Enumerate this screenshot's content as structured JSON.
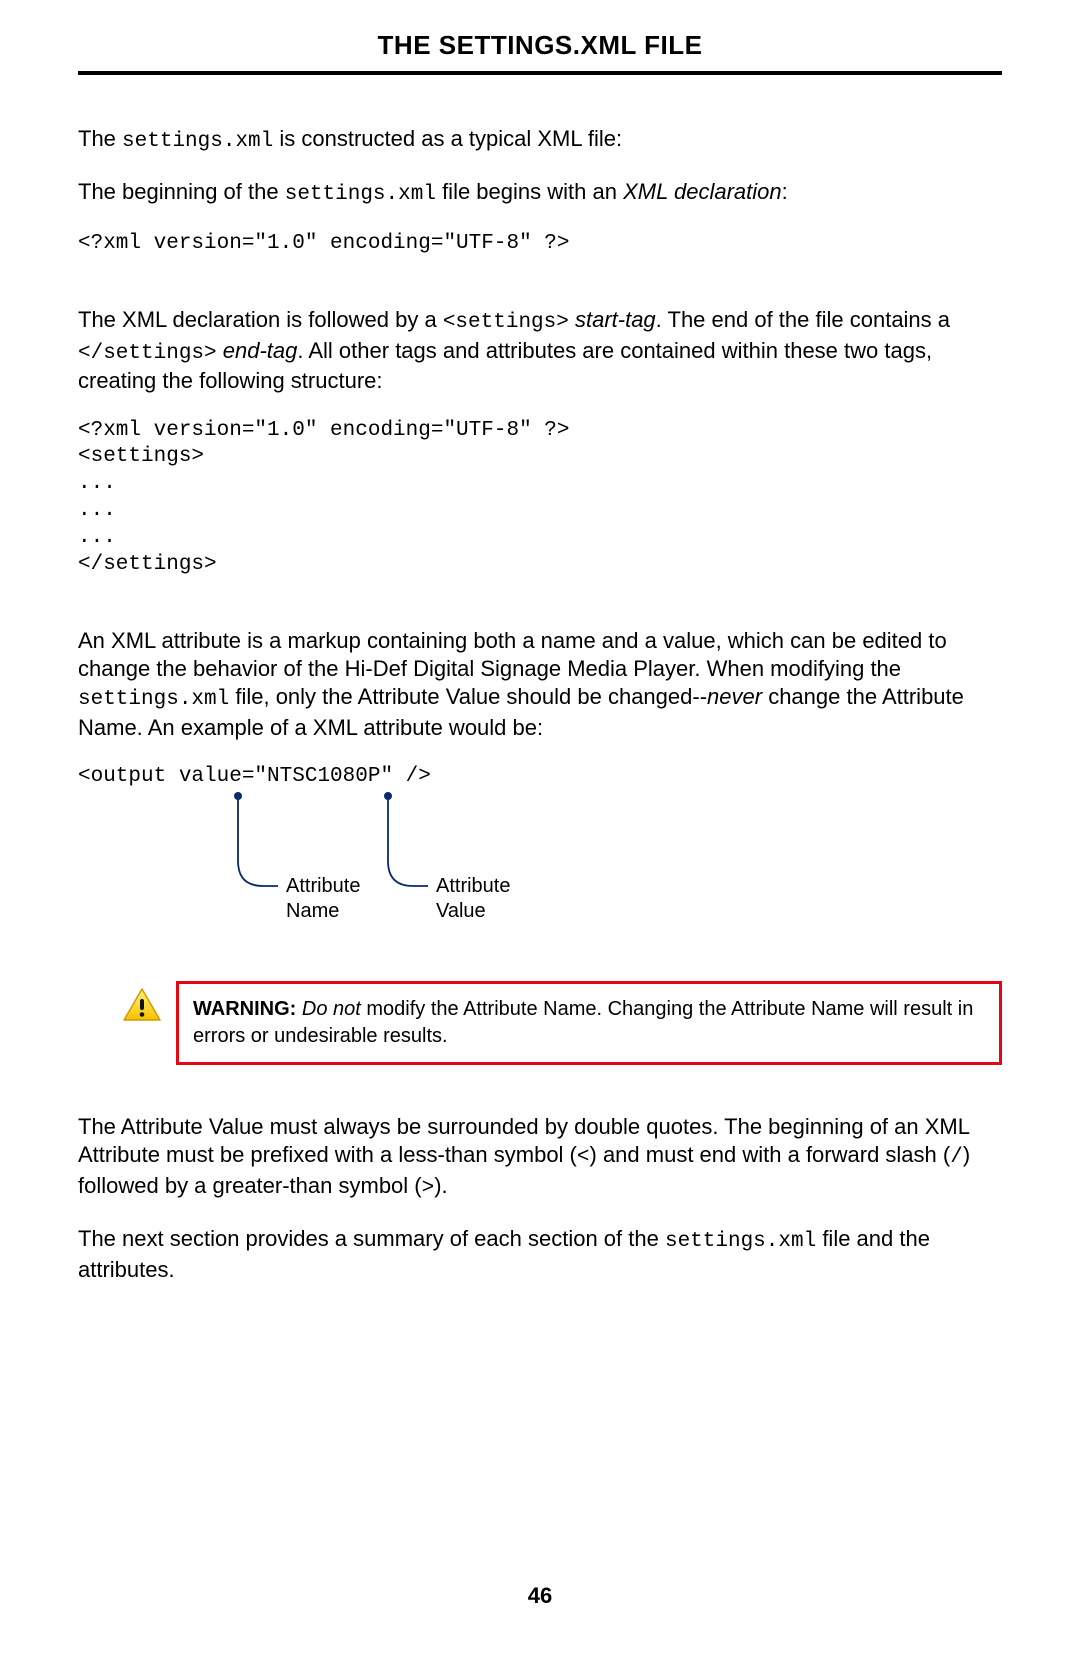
{
  "header": {
    "title": "THE SETTINGS.XML FILE"
  },
  "p1": {
    "pre": "The ",
    "code": "settings.xml",
    "post": " is constructed as a typical XML file:"
  },
  "p2": {
    "pre": "The beginning of the ",
    "code": "settings.xml",
    "mid": " file begins with an ",
    "ital": "XML declaration",
    "post": ":"
  },
  "code1": "<?xml version=\"1.0\" encoding=\"UTF-8\" ?>",
  "p3": {
    "pre": "The XML declaration is followed by a ",
    "code1": "<settings>",
    "ital1": " start-tag",
    "mid1": ".  The end of the file contains a ",
    "code2": "</settings>",
    "ital2": " end-tag",
    "post": ".  All other tags and attributes are contained within these two tags, creating the following structure:"
  },
  "code2": "<?xml version=\"1.0\" encoding=\"UTF-8\" ?>\n<settings>\n...\n...\n...\n</settings>",
  "p4": {
    "pre": "An XML attribute is a markup containing both a name and a value, which can be edited to change the behavior of the Hi-Def Digital Signage Media Player.  When modifying the ",
    "code": "settings.xml",
    "mid": " file, only the Attribute Value should be changed--",
    "ital": "never",
    "post": " change the Attribute Name.  An example of a XML attribute would be:"
  },
  "code3": "<output value=\"NTSC1080P\" />",
  "diagram": {
    "label1_line1": "Attribute",
    "label1_line2": "Name",
    "label2_line1": "Attribute",
    "label2_line2": "Value"
  },
  "warning": {
    "label": "WARNING:",
    "ital": " Do not",
    "text": " modify the Attribute Name.  Changing the Attribute Name will result in errors or undesirable results."
  },
  "p5": {
    "pre": "The Attribute Value must always be surrounded by double quotes.  The beginning of an XML Attribute must be prefixed with a less-than symbol (",
    "code1": "<",
    "mid1": ") and must end with a forward slash (",
    "code2": "/",
    "mid2": ") followed by a greater-than symbol (",
    "code3": ">",
    "post": ")."
  },
  "p6": {
    "pre": "The next section provides a summary of each section of the ",
    "code": "settings.xml",
    "post": " file and the attributes."
  },
  "page_number": "46"
}
